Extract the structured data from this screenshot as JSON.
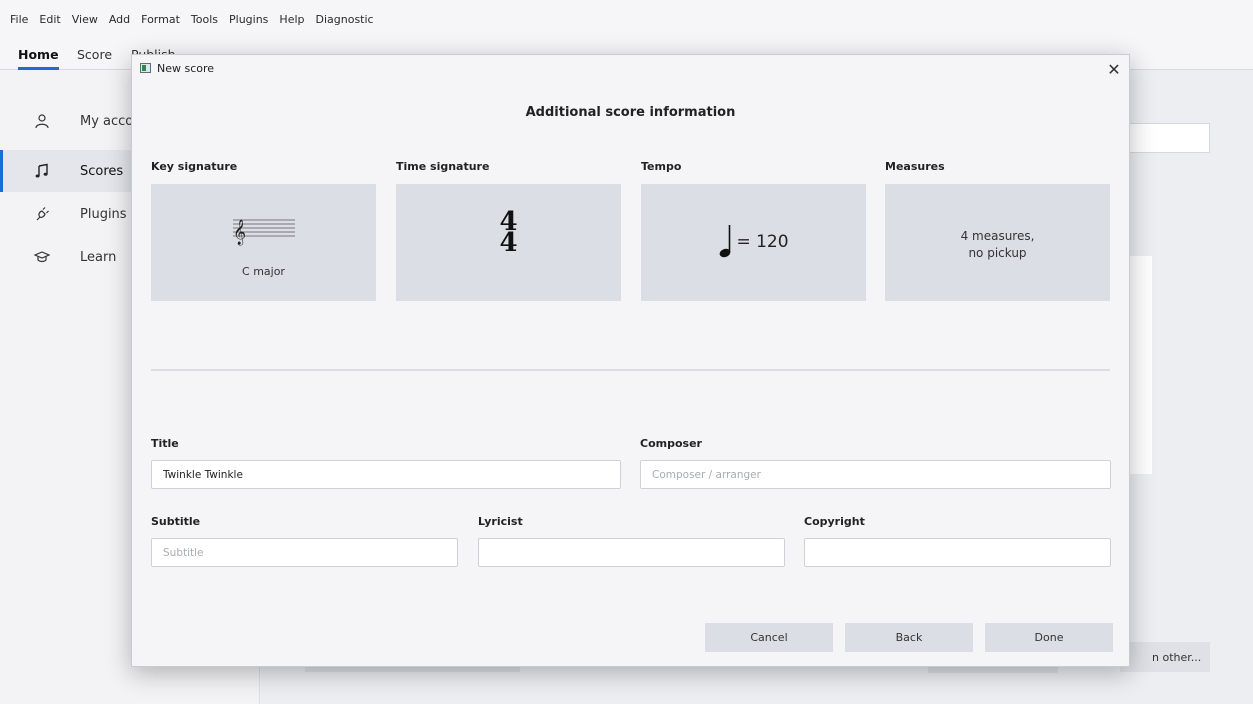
{
  "menubar": [
    "File",
    "Edit",
    "View",
    "Add",
    "Format",
    "Tools",
    "Plugins",
    "Help",
    "Diagnostic"
  ],
  "tabs": [
    "Home",
    "Score",
    "Publish"
  ],
  "sidebar": {
    "items": [
      {
        "label": "My acco",
        "icon": "user-icon"
      },
      {
        "label": "Scores",
        "icon": "music-note-icon"
      },
      {
        "label": "Plugins",
        "icon": "plug-icon"
      },
      {
        "label": "Learn",
        "icon": "mortarboard-icon"
      }
    ]
  },
  "background": {
    "other_button": "n other..."
  },
  "dialog": {
    "window_title": "New score",
    "heading": "Additional score information",
    "sections": {
      "key_signature": {
        "label": "Key signature",
        "value": "C major"
      },
      "time_signature": {
        "label": "Time signature",
        "numerator": "4",
        "denominator": "4"
      },
      "tempo": {
        "label": "Tempo",
        "value": "= 120"
      },
      "measures": {
        "label": "Measures",
        "line1": "4 measures,",
        "line2": "no pickup"
      }
    },
    "fields": {
      "title": {
        "label": "Title",
        "value": "Twinkle Twinkle",
        "placeholder": ""
      },
      "composer": {
        "label": "Composer",
        "value": "",
        "placeholder": "Composer / arranger"
      },
      "subtitle": {
        "label": "Subtitle",
        "value": "",
        "placeholder": "Subtitle"
      },
      "lyricist": {
        "label": "Lyricist",
        "value": "",
        "placeholder": ""
      },
      "copyright": {
        "label": "Copyright",
        "value": "",
        "placeholder": ""
      }
    },
    "buttons": {
      "cancel": "Cancel",
      "back": "Back",
      "done": "Done"
    }
  },
  "colors": {
    "accent": "#1b6bd8",
    "card": "#dcdee5",
    "dialog_bg": "#f5f5f7"
  }
}
